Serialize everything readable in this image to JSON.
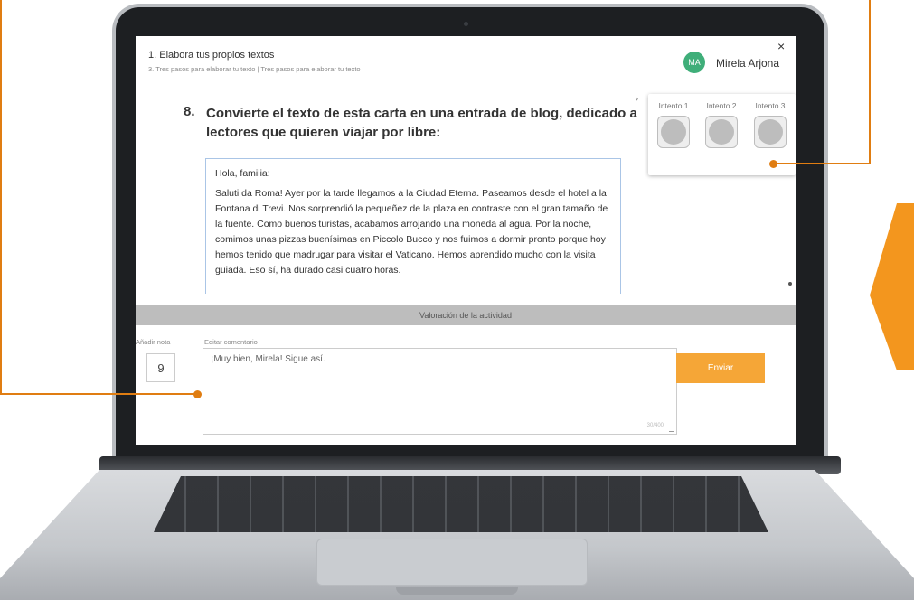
{
  "header": {
    "title": "1. Elabora tus propios textos",
    "subtitle": "3. Tres pasos para elaborar tu texto | Tres pasos para elaborar tu texto",
    "user_initials": "MA",
    "user_name": "Mirela Arjona",
    "close_glyph": "×"
  },
  "question": {
    "number": "8.",
    "text": "Convierte el texto de esta carta en una entrada de blog, dedicado a lectores que quieren viajar por libre:"
  },
  "letter": {
    "greeting": "Hola, familia:",
    "body": "Saluti da Roma! Ayer por la tarde llegamos a la Ciudad Eterna. Paseamos desde el hotel a la Fontana di Trevi. Nos sorprendió la pequeñez de la plaza en contraste con el gran tamaño de la fuente. Como buenos turistas, acabamos arrojando una moneda al agua. Por la noche, comimos unas pizzas buenísimas en Piccolo Bucco y nos fuimos a dormir pronto porque hoy hemos tenido que madrugar para visitar el Vaticano. Hemos aprendido mucho con la visita guiada. Eso sí, ha durado casi cuatro horas."
  },
  "attempts": {
    "toggle": "›",
    "items": [
      "Intento 1",
      "Intento 2",
      "Intento 3"
    ]
  },
  "evaluation": {
    "bar_label": "Valoración de la actividad",
    "grade_label": "Añadir nota",
    "grade_value": "9",
    "comment_label": "Editar comentario",
    "comment_value": "¡Muy bien, Mirela! Sigue así.",
    "counter": "30/400",
    "send_label": "Enviar"
  },
  "colors": {
    "accent": "#f5a637",
    "callout": "#e07d12",
    "avatar": "#3fae79"
  }
}
